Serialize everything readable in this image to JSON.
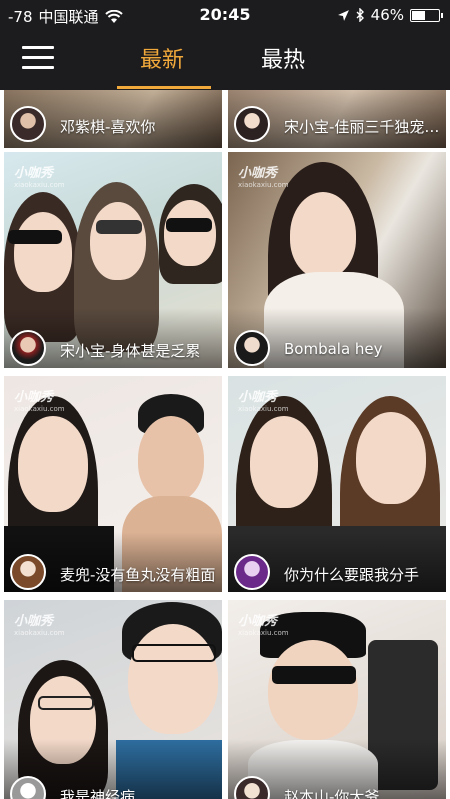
{
  "status_bar": {
    "signal": "-78",
    "carrier": "中国联通",
    "time": "20:45",
    "battery": "46%",
    "battery_level": 0.46
  },
  "nav": {
    "tabs": [
      {
        "label": "最新",
        "active": true
      },
      {
        "label": "最热",
        "active": false
      }
    ]
  },
  "watermark": {
    "brand": "小咖秀",
    "site": "xiaokaxiu.com"
  },
  "videos": [
    {
      "title": "邓紫棋-喜欢你"
    },
    {
      "title": "宋小宝-佳丽三千独宠你一人"
    },
    {
      "title": "宋小宝-身体甚是乏累"
    },
    {
      "title": "Bombala hey"
    },
    {
      "title": "麦兜-没有鱼丸没有粗面"
    },
    {
      "title": "你为什么要跟我分手"
    },
    {
      "title": "我是神经病"
    },
    {
      "title": "赵本山-你大爷"
    }
  ],
  "colors": {
    "accent": "#f2a93b",
    "bar": "#1c1c1e"
  }
}
